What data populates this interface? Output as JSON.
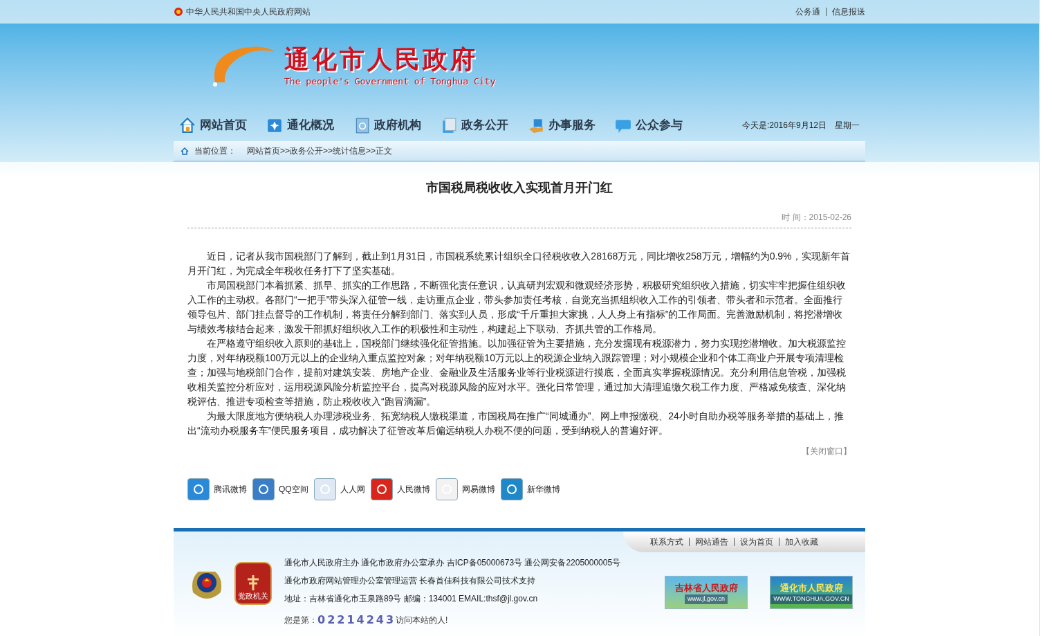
{
  "top_bar": {
    "site_link": "中华人民共和国中央人民政府网站",
    "links": [
      "公务通",
      "信息报送"
    ]
  },
  "header": {
    "title": "通化市人民政府",
    "subtitle": "The people's Government of Tonghua City"
  },
  "nav": {
    "items": [
      "网站首页",
      "通化概况",
      "政府机构",
      "政务公开",
      "办事服务",
      "公众参与"
    ],
    "date": "今天是:2016年9月12日",
    "weekday": "星期一"
  },
  "breadcrumb": {
    "label": "当前位置：",
    "path": "网站首页>>政务公开>>统计信息>>正文"
  },
  "article": {
    "title": "市国税局税收收入实现首月开门红",
    "time_label": "时 间：",
    "date": "2015-02-26",
    "paragraphs": [
      "近日，记者从我市国税部门了解到，截止到1月31日，市国税系统累计组织全口径税收收入28168万元，同比增收258万元，增幅约为0.9%，实现新年首月开门红，为完成全年税收任务打下了坚实基础。",
      "市局国税部门本着抓紧、抓早、抓实的工作思路，不断强化责任意识，认真研判宏观和微观经济形势，积极研究组织收入措施，切实牢牢把握住组织收入工作的主动权。各部门“一把手”带头深入征管一线，走访重点企业，带头参加责任考核，自觉充当抓组织收入工作的引领者、带头者和示范者。全面推行领导包片、部门挂点督导的工作机制，将责任分解到部门、落实到人员，形成“千斤重担大家挑，人人身上有指标”的工作局面。完善激励机制，将挖潜增收与绩效考核结合起来，激发干部抓好组织收入工作的积极性和主动性，构建起上下联动、齐抓共管的工作格局。",
      "在严格遵守组织收入原则的基础上，国税部门继续强化征管措施。以加强征管为主要措施，充分发掘现有税源潜力，努力实现挖潜增收。加大税源监控力度，对年纳税额100万元以上的企业纳入重点监控对象；对年纳税额10万元以上的税源企业纳入跟踪管理；对小规模企业和个体工商业户开展专项清理检查；加强与地税部门合作，提前对建筑安装、房地产企业、金融业及生活服务业等行业税源进行摸底，全面真实掌握税源情况。充分利用信息管税，加强税收相关监控分析应对，运用税源风险分析监控平台，提高对税源风险的应对水平。强化日常管理，通过加大清理追缴欠税工作力度、严格减免核查、深化纳税评估、推进专项检查等措施，防止税收收入“跑冒滴漏”。",
      "为最大限度地方便纳税人办理涉税业务、拓宽纳税人缴税渠道，市国税局在推广“同城通办”、网上申报缴税、24小时自助办税等服务举措的基础上，推出“流动办税服务车”便民服务项目，成功解决了征管改革后偏远纳税人办税不便的问题，受到纳税人的普遍好评。"
    ],
    "close_link": "【关闭窗口】"
  },
  "share": [
    "腾讯微博",
    "QQ空间",
    "人人网",
    "人民微博",
    "网易微博",
    "新华微博"
  ],
  "footer": {
    "links": [
      "联系方式",
      "网站通告",
      "设为首页",
      "加入收藏"
    ],
    "lines": [
      "通化市人民政府主办 通化市政府办公室承办 吉ICP备05000673号 通公网安备2205000005号",
      "通化市政府网站管理办公室管理运营 长春首佳科技有限公司技术支持",
      "地址：吉林省通化市玉泉路89号 邮编：134001 EMAIL:thsf@jl.gov.cn"
    ],
    "badge": "党政机关",
    "counter_prefix": "您是第：",
    "counter": "02214243",
    "counter_suffix": "访问本站的人!",
    "banners": [
      {
        "title": "吉林省人民政府",
        "url": "www.jl.gov.cn"
      },
      {
        "title": "通化市人民政府",
        "url": "WWW.TONGHUA.GOV.CN"
      }
    ]
  }
}
